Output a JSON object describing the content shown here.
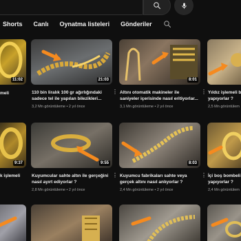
{
  "tabs": [
    "Shorts",
    "Canlı",
    "Oynatma listeleri",
    "Gönderiler"
  ],
  "icons": {
    "search": "search-icon",
    "mic": "mic-icon",
    "tab_search": "search-icon"
  },
  "videos": [
    {
      "duration": "11:02",
      "title1": "meli",
      "title2": "",
      "meta": ""
    },
    {
      "duration": "21:03",
      "title1": "110 bin liralık 100 gr ağırlığındaki",
      "title2": "sadece tel ile yapılan bilezikleri...",
      "meta": "3,2 Mn görüntüleme • 2 yıl önce"
    },
    {
      "duration": "8:01",
      "title1": "Altını otomatik makineler ile",
      "title2": "saniyeler içerisinde nasıl eritiyorlar...",
      "meta": "3,1 Mn görüntüleme • 2 yıl önce"
    },
    {
      "duration": "",
      "title1": "Yıldız işlemeli bi",
      "title2": "yapıyorlar ?",
      "meta": "2,5 Mn görüntülem"
    },
    {
      "duration": "9:37",
      "title1": "k işlemeli",
      "title2": "",
      "meta": ""
    },
    {
      "duration": "9:55",
      "title1": "Kuyumcular sahte altın ile gerçeğini",
      "title2": "nasıl ayırt ediyorlar ?",
      "meta": "2,8 Mn görüntüleme • 2 yıl önce"
    },
    {
      "duration": "8:03",
      "title1": "Kuyumcu fabrikaları sahte veya",
      "title2": "gerçek altını nasıl anlıyorlar ?",
      "meta": "2,4 Mn görüntüleme • 2 yıl önce"
    },
    {
      "duration": "",
      "title1": "İçi boş bombeli bi",
      "title2": "yapıyorlar ?",
      "meta": "2,4 Mn görüntülem"
    }
  ]
}
